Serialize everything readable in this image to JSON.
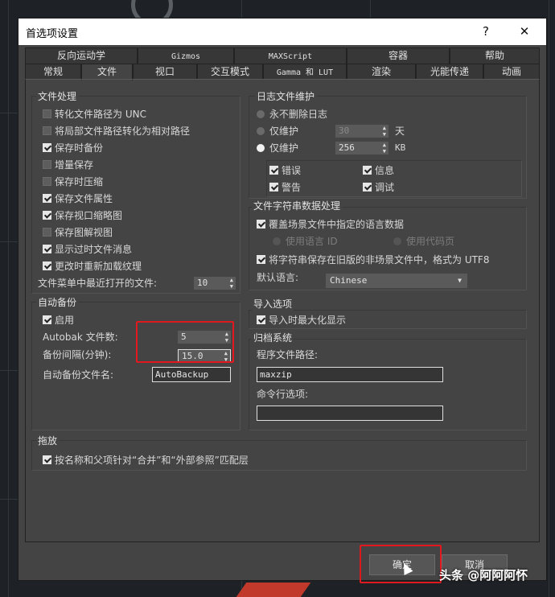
{
  "window": {
    "title": "首选项设置",
    "help": "?",
    "close": "✕"
  },
  "tabs_row1": [
    "反向运动学",
    "Gizmos",
    "MAXScript",
    "容器",
    "帮助"
  ],
  "tabs_row2": [
    "常规",
    "文件",
    "视口",
    "交互模式",
    "Gamma 和 LUT",
    "渲染",
    "光能传递",
    "动画"
  ],
  "active_tab": "文件",
  "file_handling": {
    "label": "文件处理",
    "options": [
      {
        "text": "转化文件路径为 UNC",
        "checked": false
      },
      {
        "text": "将局部文件路径转化为相对路径",
        "checked": false
      },
      {
        "text": "保存时备份",
        "checked": true
      },
      {
        "text": "增量保存",
        "checked": false
      },
      {
        "text": "保存时压缩",
        "checked": false
      },
      {
        "text": "保存文件属性",
        "checked": true
      },
      {
        "text": "保存视口缩略图",
        "checked": true
      },
      {
        "text": "保存图解视图",
        "checked": false
      },
      {
        "text": "显示过时文件消息",
        "checked": true
      },
      {
        "text": "更改时重新加载纹理",
        "checked": true
      }
    ],
    "recent_label": "文件菜单中最近打开的文件:",
    "recent_value": "10"
  },
  "log": {
    "label": "日志文件维护",
    "never_delete": "永不删除日志",
    "keep_days_label": "仅维护",
    "keep_days_value": "30",
    "days_unit": "天",
    "keep_kb_label": "仅维护",
    "keep_kb_value": "256",
    "kb_unit": "KB",
    "checks": [
      {
        "text": "错误",
        "checked": true
      },
      {
        "text": "信息",
        "checked": true
      },
      {
        "text": "警告",
        "checked": true
      },
      {
        "text": "调试",
        "checked": true
      }
    ]
  },
  "string_data": {
    "label": "文件字符串数据处理",
    "override": "覆盖场景文件中指定的语言数据",
    "use_lang": "使用语言 ID",
    "use_codepage": "使用代码页",
    "save_utf8": "将字符串保存在旧版的非场景文件中，格式为 UTF8",
    "default_lang_label": "默认语言:",
    "default_lang": "Chinese"
  },
  "autobackup": {
    "label": "自动备份",
    "enable": "启用",
    "count_label": "Autobak 文件数:",
    "count_value": "5",
    "interval_label": "备份间隔(分钟):",
    "interval_value": "15.0",
    "name_label": "自动备份文件名:",
    "name_value": "AutoBackup"
  },
  "import": {
    "label": "导入选项",
    "maximize": "导入时最大化显示"
  },
  "archive": {
    "label": "归档系统",
    "program_label": "程序文件路径:",
    "program_value": "maxzip",
    "cmdline_label": "命令行选项:",
    "cmdline_value": ""
  },
  "drag": {
    "label": "拖放",
    "match": "按名称和父项针对“合并”和“外部参照”匹配层"
  },
  "buttons": {
    "ok": "确定",
    "cancel": "取消"
  },
  "watermark": "头条 @阿阿阿怀",
  "accent_red": "#e0191f"
}
